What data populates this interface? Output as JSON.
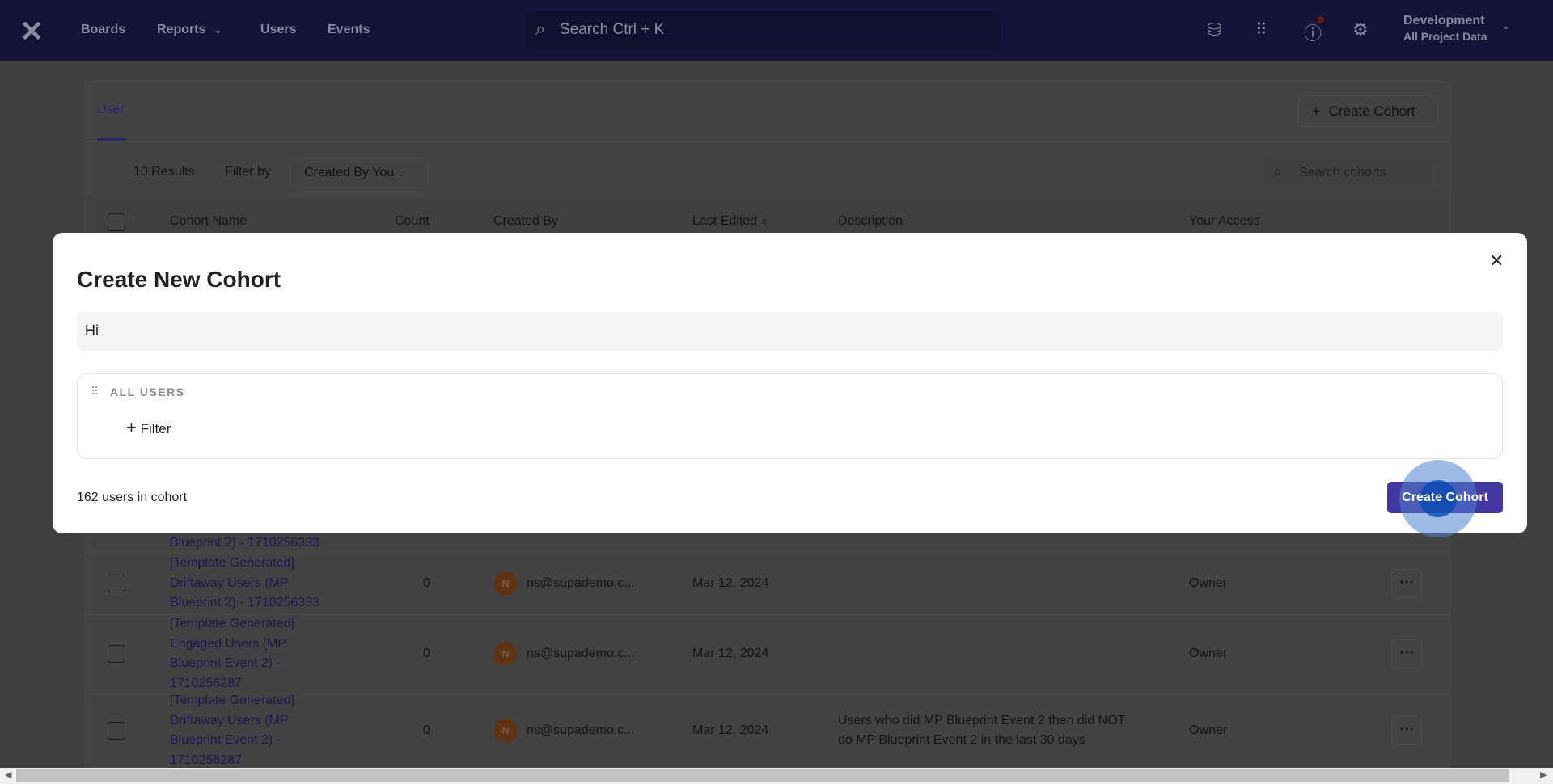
{
  "nav": {
    "items": [
      "Boards",
      "Reports",
      "Users",
      "Events"
    ],
    "search_placeholder": "Search  Ctrl + K",
    "project": "Development",
    "project_sub": "All Project Data",
    "brand_color": "#4f45d8",
    "help_badge_color": "#d9480f"
  },
  "page": {
    "tab": "User",
    "create_button": "Create Cohort",
    "results": "10 Results",
    "filter_by": "Filter by",
    "filter_value": "Created By You",
    "search_placeholder": "Search cohorts"
  },
  "table": {
    "headers": [
      "Cohort Name",
      "Count",
      "Created By",
      "Last Edited",
      "Description",
      "Your Access"
    ],
    "partial_row_tail": "Blueprint 2) - 1710256333",
    "rows": [
      {
        "name": [
          "[Template Generated]",
          "Driftaway Users (MP",
          "Blueprint 2) - 1710256333"
        ],
        "count": "0",
        "avatar": "N",
        "created_by": "ns@supademo.c...",
        "last_edited": "Mar 12, 2024",
        "description": [],
        "access": "Owner"
      },
      {
        "name": [
          "[Template Generated]",
          "Engaged Users (MP",
          "Blueprint Event 2) -",
          "1710256287"
        ],
        "count": "0",
        "avatar": "N",
        "created_by": "ns@supademo.c...",
        "last_edited": "Mar 12, 2024",
        "description": [],
        "access": "Owner"
      },
      {
        "name": [
          "[Template Generated]",
          "Driftaway Users (MP",
          "Blueprint Event 2) -",
          "1710256287"
        ],
        "count": "0",
        "avatar": "N",
        "created_by": "ns@supademo.c...",
        "last_edited": "Mar 12, 2024",
        "description": [
          "Users who did MP Blueprint Event 2 then did NOT",
          "do MP Blueprint Event 2 in the last 30 days"
        ],
        "access": "Owner"
      }
    ]
  },
  "modal": {
    "title": "Create New Cohort",
    "name_value": "Hi",
    "group_label": "ALL USERS",
    "add_filter": "Filter",
    "count_text": "162 users in cohort",
    "submit": "Create Cohort",
    "submit_color": "#4337a3"
  }
}
